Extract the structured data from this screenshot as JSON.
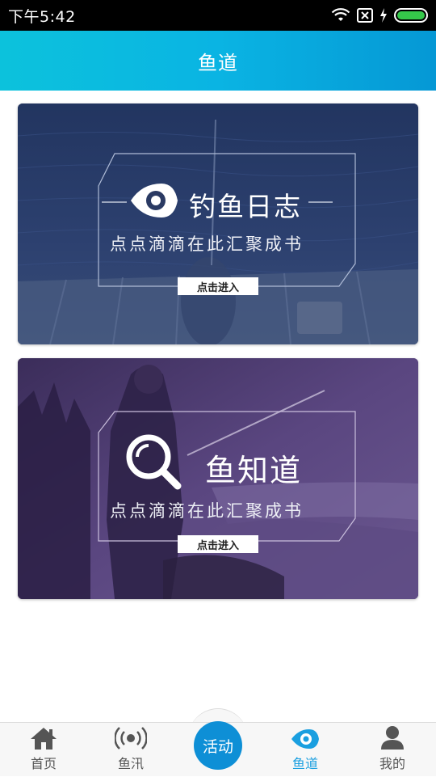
{
  "status": {
    "time": "下午5:42"
  },
  "header": {
    "title": "鱼道"
  },
  "cards": [
    {
      "title": "钓鱼日志",
      "slogan": "点点滴滴在此汇聚成书",
      "button": "点击进入",
      "icon": "fish-eye-icon"
    },
    {
      "title": "鱼知道",
      "slogan": "点点滴滴在此汇聚成书",
      "button": "点击进入",
      "icon": "magnifier-icon"
    }
  ],
  "tabs": [
    {
      "label": "首页",
      "icon": "home-icon"
    },
    {
      "label": "鱼汛",
      "icon": "broadcast-icon"
    },
    {
      "label": "活动",
      "icon": "activity-button"
    },
    {
      "label": "鱼道",
      "icon": "fish-eye-icon",
      "active": true
    },
    {
      "label": "我的",
      "icon": "user-icon"
    }
  ],
  "colors": {
    "accent": "#1a9fe0",
    "header_start": "#0cc2dc",
    "header_end": "#0598d5"
  }
}
